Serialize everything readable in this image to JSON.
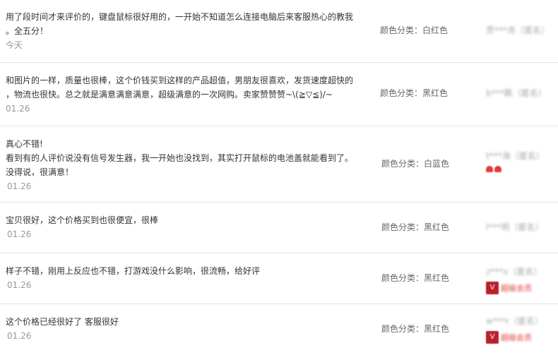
{
  "reviews": [
    {
      "lines": [
        "用了段时间才来评价的，键盘鼠标很好用的，一开始不知道怎么连接电脑后来客服热心的教我",
        "。全五分！"
      ],
      "date": "今天",
      "sku": "颜色分类：白红色",
      "user": "贾***尧（匿名）",
      "badge": "none"
    },
    {
      "lines": [
        "和图片的一样，质量也很棒，这个价钱买到这样的产品超值，男朋友很喜欢，发货速度超快的",
        "，物流也很快。总之就是满意满意满意，超级满意的一次网购。卖家赞赞赞~\\(≧▽≦)/~"
      ],
      "date": "01.26",
      "sku": "颜色分类：黑红色",
      "user": "b***鹏（匿名）",
      "badge": "none"
    },
    {
      "lines": [
        "真心不错!",
        "看到有的人评价说没有信号发生器，我一开始也没找到，其实打开鼠标的电池盖就能看到了。",
        "没得说，很满意！"
      ],
      "date": "01.26",
      "sku": "颜色分类：白蓝色",
      "user": "t***海（匿名）",
      "badge": "hearts"
    },
    {
      "lines": [
        "宝贝很好，这个价格买到也很便宜，很棒"
      ],
      "date": "01.26",
      "sku": "颜色分类：黑红色",
      "user": "l***明（匿名）",
      "badge": "none"
    },
    {
      "lines": [
        "样子不错，刚用上反应也不错，打游戏没什么影响，很流畅，给好评"
      ],
      "date": "01.26",
      "sku": "颜色分类：黑红色",
      "user": "z***x（匿名）",
      "badge": "vip",
      "vip_text": "超级会员"
    },
    {
      "lines": [
        "这个价格已经很好了 客服很好"
      ],
      "date": "01.26",
      "sku": "颜色分类：黑红色",
      "user": "w***r（匿名）",
      "badge": "vip",
      "vip_text": "超级会员"
    }
  ]
}
